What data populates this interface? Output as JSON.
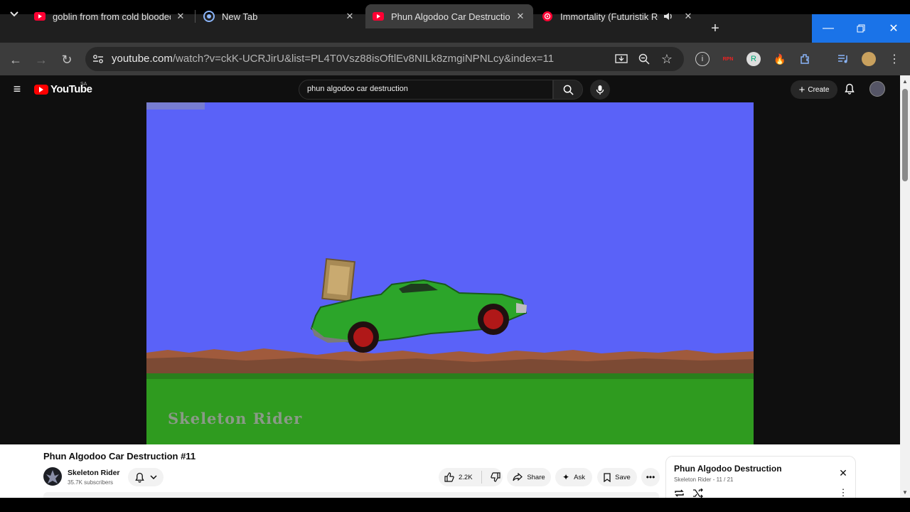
{
  "browser": {
    "tabs": [
      {
        "title": "goblin from from cold blooded",
        "favicon": "youtube-icon",
        "active": false
      },
      {
        "title": "New Tab",
        "favicon": "chrome-icon",
        "active": false
      },
      {
        "title": "Phun Algodoo Car Destruction",
        "favicon": "youtube-icon",
        "active": true
      },
      {
        "title": "Immortality (Futuristik Remi",
        "favicon": "youtube-music-icon",
        "active": false
      }
    ],
    "url_host": "youtube.com",
    "url_path": "/watch?v=ckK-UCRJirU&list=PL4T0Vsz88isOftlEv8NILk8zmgiNPNLcy&index=11",
    "accent_color": "#1a73e8"
  },
  "youtube": {
    "logo_text": "YouTube",
    "country_code": "SA",
    "search_query": "phun algodoo car destruction",
    "create_label": "Create"
  },
  "video": {
    "watermark": "Skeleton Rider",
    "sky_color": "#5a62f8",
    "grass_color": "#2f9b1f",
    "car_color": "#2ca52a"
  },
  "details": {
    "title": "Phun Algodoo Car Destruction #11",
    "channel": "Skeleton Rider",
    "subscribers": "35.7K subscribers",
    "likes": "2.2K",
    "share_label": "Share",
    "ask_label": "Ask",
    "save_label": "Save"
  },
  "playlist": {
    "title": "Phun Algodoo Destruction",
    "channel": "Skeleton Rider",
    "position": "11 / 21"
  }
}
